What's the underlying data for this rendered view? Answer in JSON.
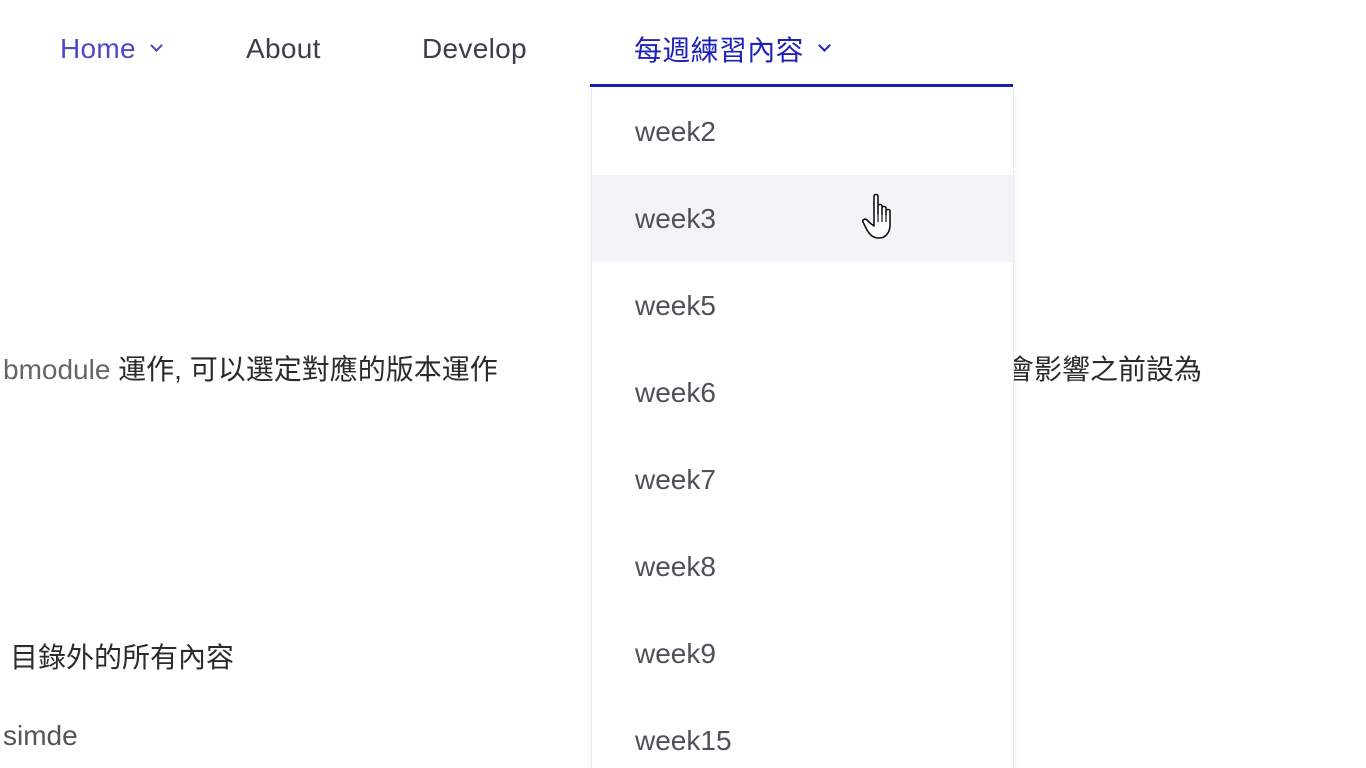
{
  "nav": {
    "home": "Home",
    "about": "About",
    "develop": "Develop",
    "weekly": "每週練習內容"
  },
  "content": {
    "line1_code": "bmodule",
    "line1_text": " 運作, 可以選定對應的版本運作",
    "line1_tail": "會影響之前設為",
    "line2": "目錄外的所有內容",
    "line3": "simde"
  },
  "dropdown": {
    "items": [
      {
        "label": "week2"
      },
      {
        "label": "week3"
      },
      {
        "label": "week5"
      },
      {
        "label": "week6"
      },
      {
        "label": "week7"
      },
      {
        "label": "week8"
      },
      {
        "label": "week9"
      },
      {
        "label": "week15"
      }
    ],
    "hovered_label": "week3"
  },
  "colors": {
    "accent": "#1a1fb4",
    "home_link": "#4f46c8",
    "hover_bg": "#f3f4f8"
  },
  "icons": {
    "nav_dropdown": "chevron-down-icon",
    "cursor": "hand-pointer-cursor-icon"
  }
}
